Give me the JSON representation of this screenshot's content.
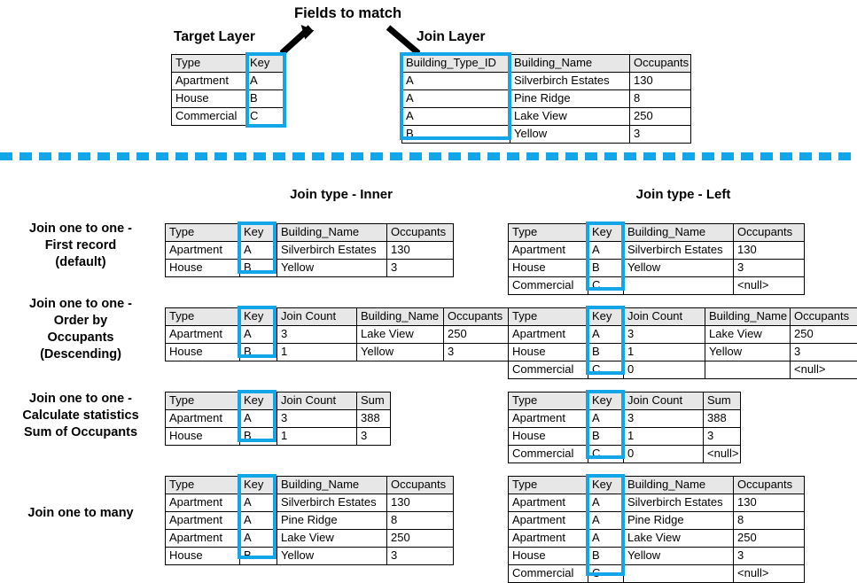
{
  "annotations": {
    "fields_to_match": "Fields to match",
    "target_layer": "Target Layer",
    "join_layer": "Join Layer",
    "arrow_left": "arrow-pointing-to-target-key",
    "arrow_right": "arrow-pointing-to-join-key"
  },
  "section_titles": {
    "inner": "Join type - Inner",
    "left": "Join type - Left"
  },
  "row_labels": {
    "row1": [
      "Join one to one -",
      "First record",
      "(default)"
    ],
    "row2": [
      "Join one to one -",
      "Order by",
      "Occupants",
      "(Descending)"
    ],
    "row3": [
      "Join one to one -",
      "Calculate statistics",
      "Sum of Occupants"
    ],
    "row4": [
      "Join one to many"
    ]
  },
  "colors": {
    "highlight": "#12a5e8",
    "header_bg": "#e7e7e7",
    "border": "#000000",
    "text": "#000000"
  },
  "tables": {
    "target_layer": {
      "headers": [
        "Type",
        "Key"
      ],
      "rows": [
        [
          "Apartment",
          "A"
        ],
        [
          "House",
          "B"
        ],
        [
          "Commercial",
          "C"
        ]
      ]
    },
    "join_layer": {
      "headers": [
        "Building_Type_ID",
        "Building_Name",
        "Occupants"
      ],
      "rows": [
        [
          "A",
          "Silverbirch Estates",
          "130"
        ],
        [
          "A",
          "Pine Ridge",
          "8"
        ],
        [
          "A",
          "Lake View",
          "250"
        ],
        [
          "B",
          "Yellow",
          "3"
        ]
      ]
    },
    "inner_first_record": {
      "headers": [
        "Type",
        "Key",
        "Building_Name",
        "Occupants"
      ],
      "rows": [
        [
          "Apartment",
          "A",
          "Silverbirch Estates",
          "130"
        ],
        [
          "House",
          "B",
          "Yellow",
          "3"
        ]
      ]
    },
    "left_first_record": {
      "headers": [
        "Type",
        "Key",
        "Building_Name",
        "Occupants"
      ],
      "rows": [
        [
          "Apartment",
          "A",
          "Silverbirch Estates",
          "130"
        ],
        [
          "House",
          "B",
          "Yellow",
          "3"
        ],
        [
          "Commercial",
          "C",
          "",
          "<null>"
        ]
      ]
    },
    "inner_order_by": {
      "headers": [
        "Type",
        "Key",
        "Join Count",
        "Building_Name",
        "Occupants"
      ],
      "rows": [
        [
          "Apartment",
          "A",
          "3",
          "Lake View",
          "250"
        ],
        [
          "House",
          "B",
          "1",
          "Yellow",
          "3"
        ]
      ]
    },
    "left_order_by": {
      "headers": [
        "Type",
        "Key",
        "Join Count",
        "Building_Name",
        "Occupants"
      ],
      "rows": [
        [
          "Apartment",
          "A",
          "3",
          "Lake View",
          "250"
        ],
        [
          "House",
          "B",
          "1",
          "Yellow",
          "3"
        ],
        [
          "Commercial",
          "C",
          "0",
          "",
          "<null>"
        ]
      ]
    },
    "inner_statistics": {
      "headers": [
        "Type",
        "Key",
        "Join Count",
        "Sum"
      ],
      "rows": [
        [
          "Apartment",
          "A",
          "3",
          "388"
        ],
        [
          "House",
          "B",
          "1",
          "3"
        ]
      ]
    },
    "left_statistics": {
      "headers": [
        "Type",
        "Key",
        "Join Count",
        "Sum"
      ],
      "rows": [
        [
          "Apartment",
          "A",
          "3",
          "388"
        ],
        [
          "House",
          "B",
          "1",
          "3"
        ],
        [
          "Commercial",
          "C",
          "0",
          "<null>"
        ]
      ]
    },
    "inner_one_to_many": {
      "headers": [
        "Type",
        "Key",
        "Building_Name",
        "Occupants"
      ],
      "rows": [
        [
          "Apartment",
          "A",
          "Silverbirch Estates",
          "130"
        ],
        [
          "Apartment",
          "A",
          "Pine Ridge",
          "8"
        ],
        [
          "Apartment",
          "A",
          "Lake View",
          "250"
        ],
        [
          "House",
          "B",
          "Yellow",
          "3"
        ]
      ]
    },
    "left_one_to_many": {
      "headers": [
        "Type",
        "Key",
        "Building_Name",
        "Occupants"
      ],
      "rows": [
        [
          "Apartment",
          "A",
          "Silverbirch Estates",
          "130"
        ],
        [
          "Apartment",
          "A",
          "Pine Ridge",
          "8"
        ],
        [
          "Apartment",
          "A",
          "Lake View",
          "250"
        ],
        [
          "House",
          "B",
          "Yellow",
          "3"
        ],
        [
          "Commercial",
          "C",
          "",
          "<null>"
        ]
      ]
    }
  }
}
